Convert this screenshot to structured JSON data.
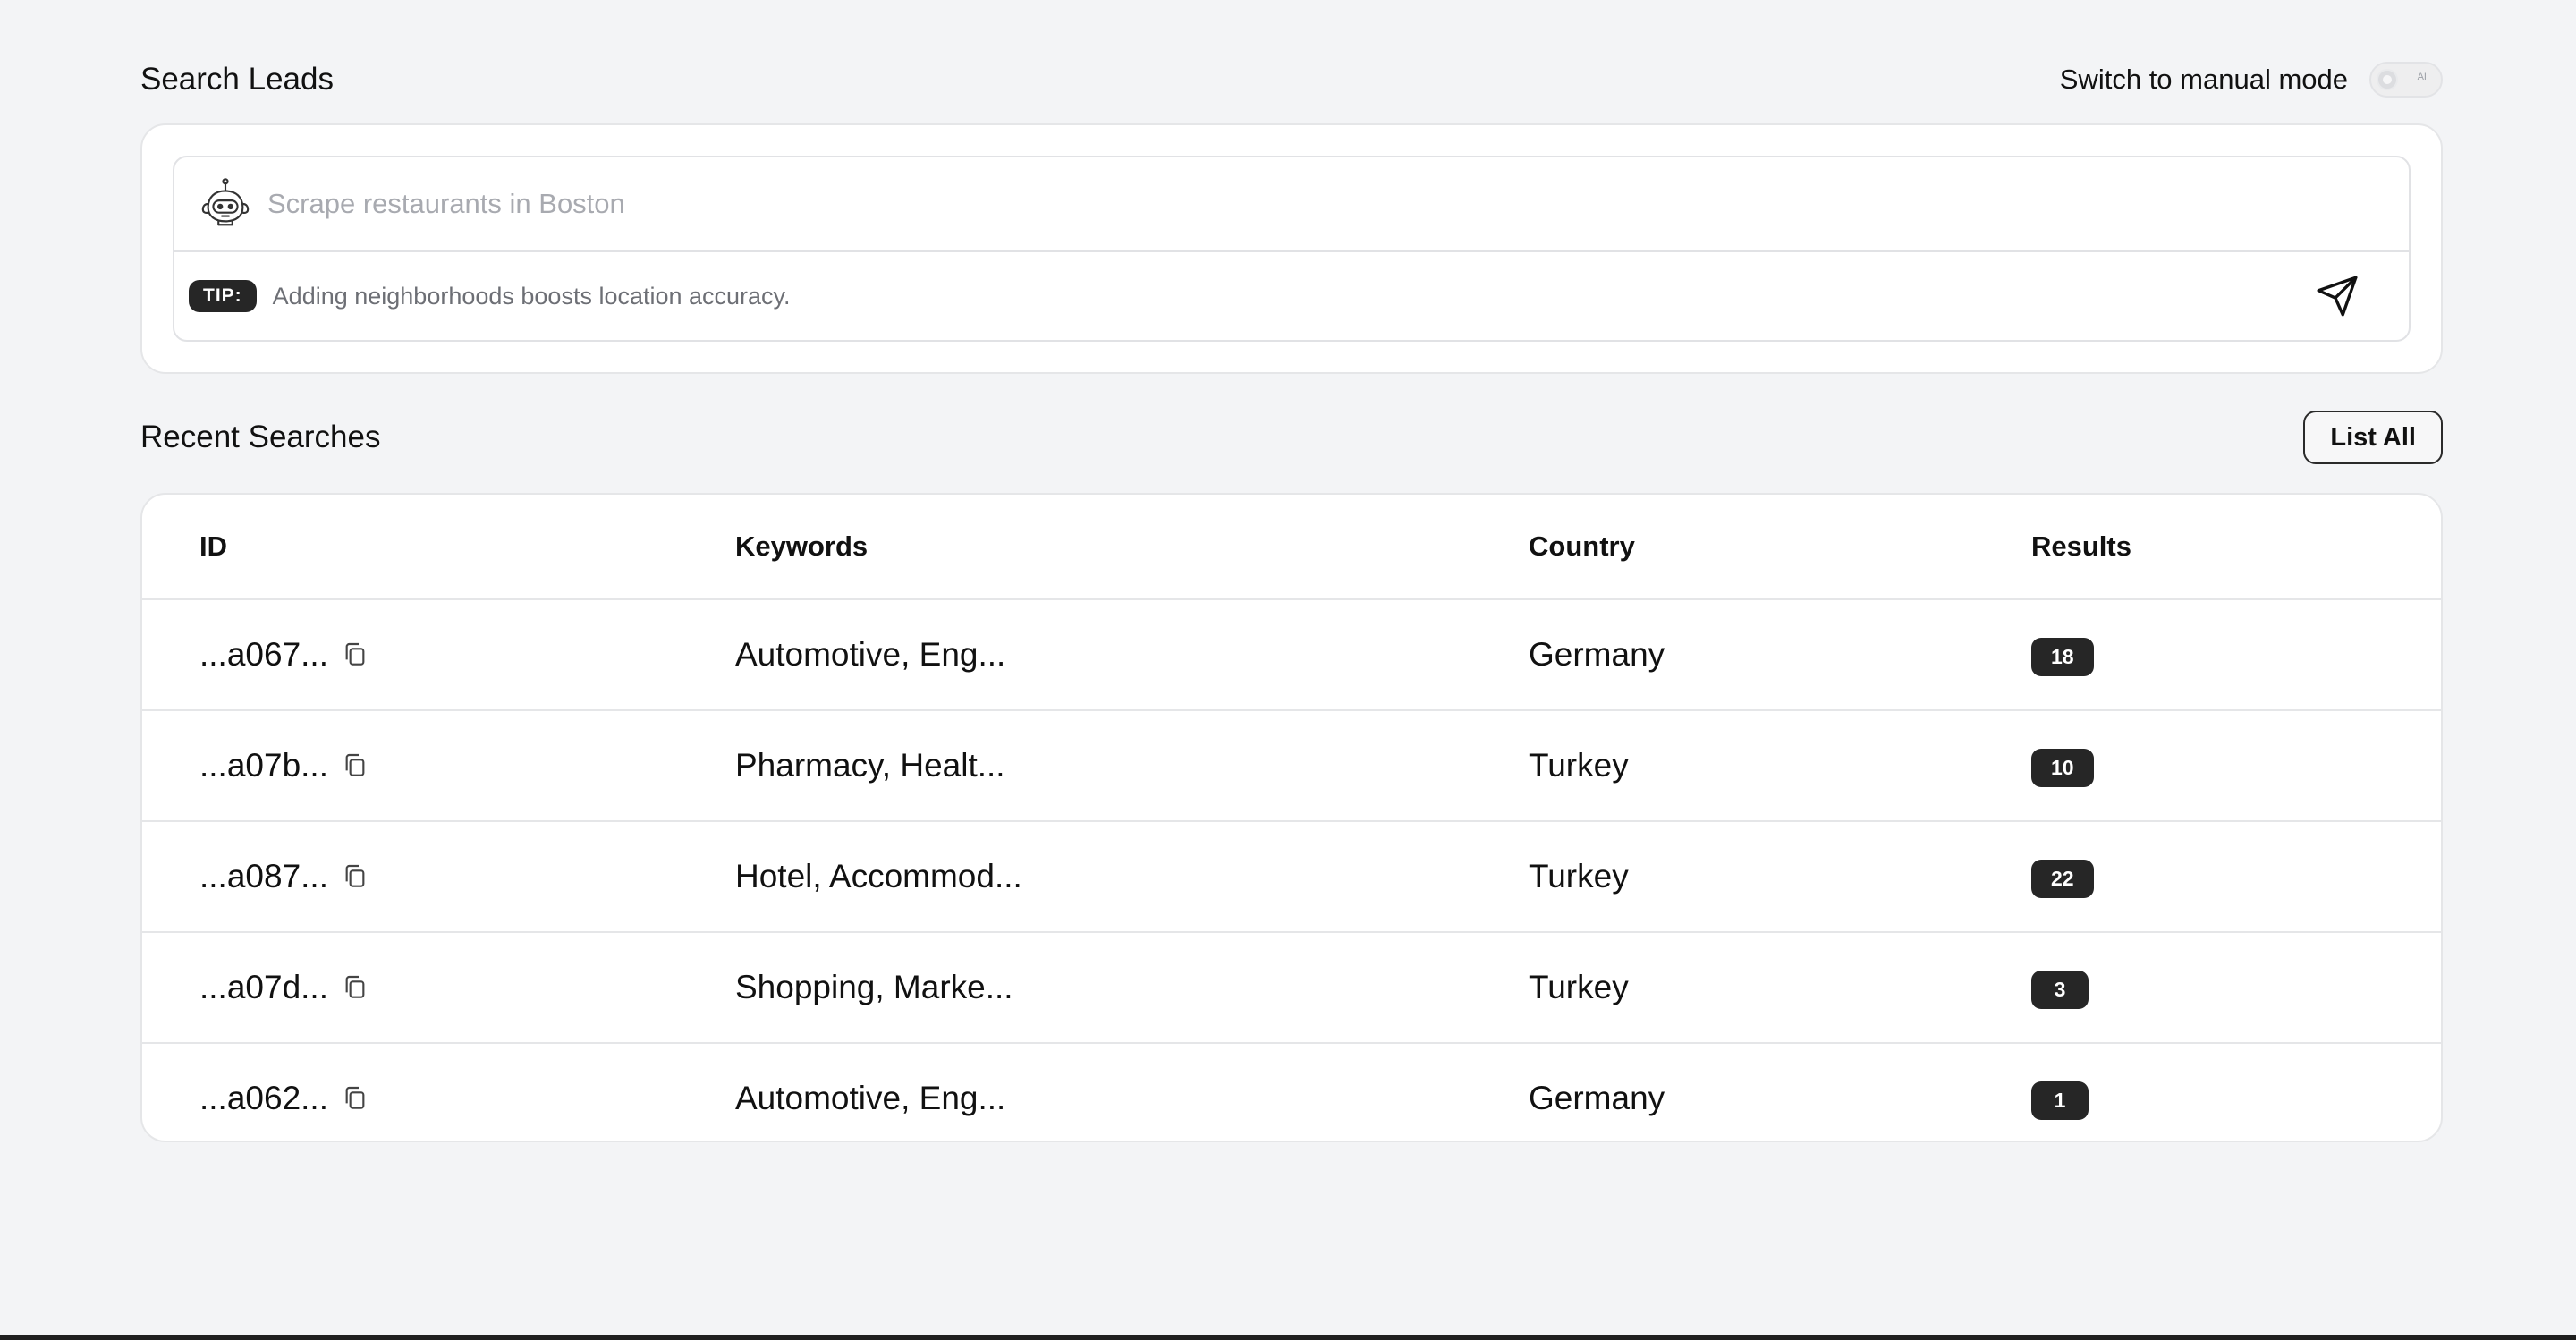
{
  "search_section": {
    "title": "Search Leads",
    "mode_switch_label": "Switch to manual mode",
    "toggle_text": "AI"
  },
  "search_box": {
    "placeholder": "Scrape restaurants in Boston",
    "value": "",
    "tip_label": "TIP:",
    "tip_text": "Adding neighborhoods boosts location accuracy."
  },
  "recent_section": {
    "title": "Recent Searches",
    "list_all_label": "List All"
  },
  "table": {
    "headers": {
      "id": "ID",
      "keywords": "Keywords",
      "country": "Country",
      "results": "Results"
    },
    "rows": [
      {
        "id": "...a067...",
        "keywords": "Automotive, Eng...",
        "country": "Germany",
        "results": "18"
      },
      {
        "id": "...a07b...",
        "keywords": "Pharmacy, Healt...",
        "country": "Turkey",
        "results": "10"
      },
      {
        "id": "...a087...",
        "keywords": "Hotel, Accommod...",
        "country": "Turkey",
        "results": "22"
      },
      {
        "id": "...a07d...",
        "keywords": "Shopping, Marke...",
        "country": "Turkey",
        "results": "3"
      },
      {
        "id": "...a062...",
        "keywords": "Automotive, Eng...",
        "country": "Germany",
        "results": "1"
      }
    ]
  },
  "icons": {
    "assistant": "robot-icon",
    "send": "paper-plane-icon",
    "copy": "copy-icon"
  },
  "colors": {
    "background": "#f3f4f6",
    "card": "#ffffff",
    "badge": "#262626",
    "border": "#e5e6e8"
  }
}
